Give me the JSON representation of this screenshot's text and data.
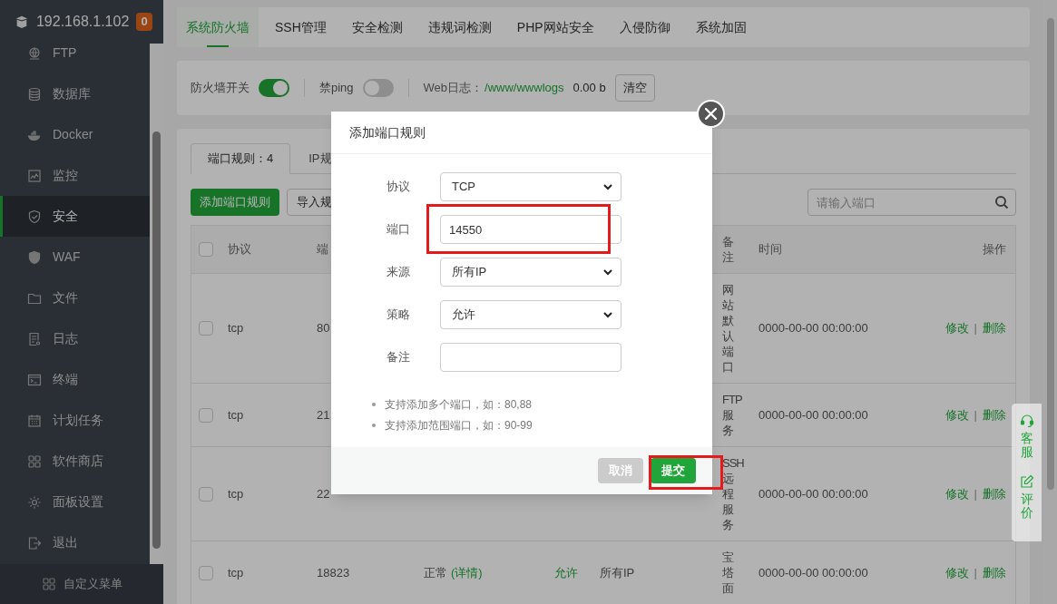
{
  "sidebar": {
    "host": "192.168.1.102",
    "badge": "0",
    "items": [
      {
        "label": "FTP",
        "selected": false
      },
      {
        "label": "数据库",
        "selected": false
      },
      {
        "label": "Docker",
        "selected": false
      },
      {
        "label": "监控",
        "selected": false
      },
      {
        "label": "安全",
        "selected": true
      },
      {
        "label": "WAF",
        "selected": false
      },
      {
        "label": "文件",
        "selected": false
      },
      {
        "label": "日志",
        "selected": false
      },
      {
        "label": "终端",
        "selected": false
      },
      {
        "label": "计划任务",
        "selected": false
      },
      {
        "label": "软件商店",
        "selected": false
      },
      {
        "label": "面板设置",
        "selected": false
      },
      {
        "label": "退出",
        "selected": false
      }
    ],
    "footer": "自定义菜单"
  },
  "top_tabs": [
    {
      "label": "系统防火墙",
      "selected": true
    },
    {
      "label": "SSH管理",
      "selected": false
    },
    {
      "label": "安全检测",
      "selected": false
    },
    {
      "label": "违规词检测",
      "selected": false
    },
    {
      "label": "PHP网站安全",
      "selected": false
    },
    {
      "label": "入侵防御",
      "selected": false
    },
    {
      "label": "系统加固",
      "selected": false
    }
  ],
  "toolbar": {
    "firewall": {
      "label": "防火墙开关",
      "on": true
    },
    "ping": {
      "label": "禁ping",
      "on": false
    },
    "web_log_label": "Web日志：",
    "web_log_path": "/www/wwwlogs",
    "web_log_size": "0.00 b",
    "clear_button": "清空"
  },
  "rule_tabs": [
    {
      "label": "端口规则：4",
      "selected": true
    },
    {
      "label": "IP规",
      "selected": false
    }
  ],
  "actions": {
    "add": "添加端口规则",
    "import": "导入规"
  },
  "search": {
    "placeholder": "请输入端口"
  },
  "table": {
    "header": {
      "checked": false,
      "protocol": "协议",
      "port": "端",
      "remark": "备注",
      "time": "时间",
      "action": "操作"
    },
    "rows": [
      {
        "checked": false,
        "protocol": "tcp",
        "port": "80",
        "remark": "网站默认端口",
        "time": "0000-00-00 00:00:00",
        "edit": "修改",
        "sep": "|",
        "delete": "删除"
      },
      {
        "checked": false,
        "protocol": "tcp",
        "port": "21",
        "remark": "FTP服务",
        "time": "0000-00-00 00:00:00",
        "edit": "修改",
        "sep": "|",
        "delete": "删除"
      },
      {
        "checked": false,
        "protocol": "tcp",
        "port": "22",
        "remark": "SSH远程服务",
        "time": "0000-00-00 00:00:00",
        "edit": "修改",
        "sep": "|",
        "delete": "删除"
      },
      {
        "checked": false,
        "protocol": "tcp",
        "port": "18823",
        "status": "正常",
        "detail": "(详情)",
        "policy": "允许",
        "source": "所有IP",
        "remark": "宝塔面",
        "time": "0000-00-00 00:00:00",
        "edit": "修改",
        "sep": "|",
        "delete": "删除"
      }
    ]
  },
  "float_panel": [
    {
      "label": "客服"
    },
    {
      "label": "评价"
    }
  ],
  "modal": {
    "title": "添加端口规则",
    "fields": [
      {
        "kind": "select",
        "label": "协议",
        "value": "TCP",
        "highlighted": false
      },
      {
        "kind": "input",
        "label": "端口",
        "value": "14550",
        "highlighted": true
      },
      {
        "kind": "select",
        "label": "来源",
        "value": "所有IP",
        "highlighted": false
      },
      {
        "kind": "select",
        "label": "策略",
        "value": "允许",
        "highlighted": false
      },
      {
        "kind": "input",
        "label": "备注",
        "highlighted": false
      }
    ],
    "notes": [
      "支持添加多个端口，如：80,88",
      "支持添加范围端口，如：90-99"
    ],
    "buttons": [
      {
        "kind": "cancel",
        "label": "取消",
        "highlighted": false
      },
      {
        "kind": "submit",
        "label": "提交",
        "highlighted": true
      }
    ]
  }
}
